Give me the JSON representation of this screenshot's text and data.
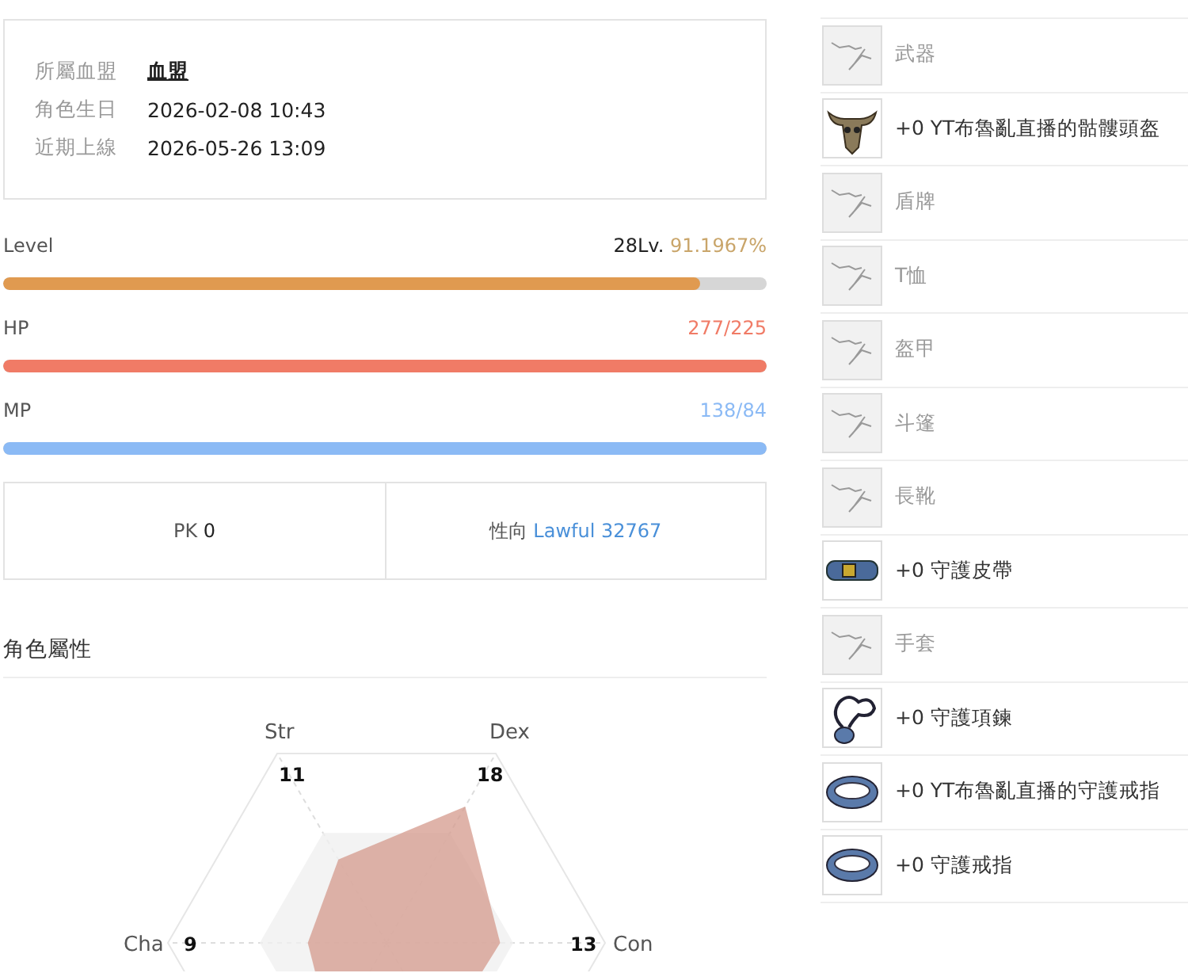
{
  "info": {
    "rows": [
      {
        "label": "所屬血盟",
        "value": "血盟",
        "kind": "link"
      },
      {
        "label": "角色生日",
        "value": "2026-02-08 10:43",
        "kind": "text"
      },
      {
        "label": "近期上線",
        "value": "2026-05-26 13:09",
        "kind": "text"
      }
    ]
  },
  "bars": [
    {
      "label": "Level",
      "reading": "28Lv.",
      "detail": "91.1967%",
      "level": 0.911967,
      "color": "#e09a50"
    },
    {
      "label": "HP",
      "reading": "277/225",
      "level": 1,
      "color": "#f07b66"
    },
    {
      "label": "MP",
      "reading": "138/84",
      "level": 1,
      "color": "#8bbaf5"
    }
  ],
  "stats": [
    {
      "label": "PK",
      "value": "0",
      "kind": "plain"
    },
    {
      "label": "性向",
      "value": "Lawful 32767",
      "kind": "alignment"
    }
  ],
  "attributes": {
    "title": "角色屬性",
    "items": [
      {
        "name": "Str",
        "value": "11"
      },
      {
        "name": "Dex",
        "value": "18"
      },
      {
        "name": "Con",
        "value": "13"
      },
      {
        "name": "Cha",
        "value": "9"
      }
    ]
  },
  "equipment": [
    {
      "name": "武器",
      "kind": "empty"
    },
    {
      "name": "+0 YT布魯亂直播的骷髏頭盔",
      "kind": "skull"
    },
    {
      "name": "盾牌",
      "kind": "empty"
    },
    {
      "name": "T恤",
      "kind": "empty"
    },
    {
      "name": "盔甲",
      "kind": "empty"
    },
    {
      "name": "斗篷",
      "kind": "empty"
    },
    {
      "name": "長靴",
      "kind": "empty"
    },
    {
      "name": "+0 守護皮帶",
      "kind": "belt"
    },
    {
      "name": "手套",
      "kind": "empty"
    },
    {
      "name": "+0 守護項鍊",
      "kind": "necklace"
    },
    {
      "name": "+0 YT布魯亂直播的守護戒指",
      "kind": "ring"
    },
    {
      "name": "+0 守護戒指",
      "kind": "ring"
    }
  ]
}
